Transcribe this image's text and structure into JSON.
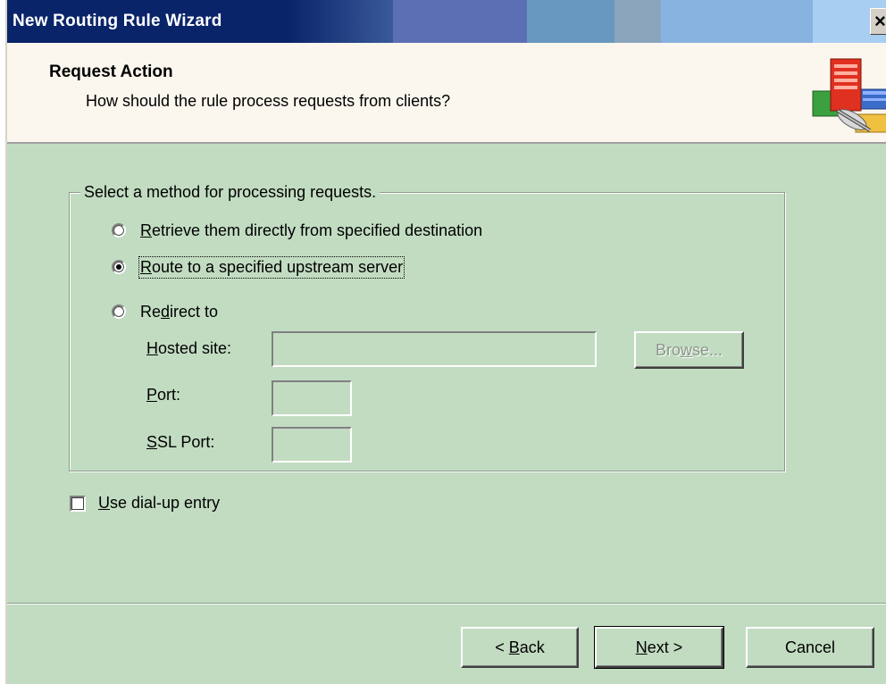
{
  "window": {
    "title": "New Routing Rule Wizard",
    "close_glyph": "×"
  },
  "header": {
    "heading": "Request Action",
    "subheading": "How should the rule process requests from clients?",
    "icon": "routing-server-icon"
  },
  "group": {
    "legend": "Select a method for processing requests.",
    "options": [
      {
        "pre": "",
        "mnemonic": "R",
        "post": "etrieve them directly from specified destination",
        "checked": false
      },
      {
        "pre": "",
        "mnemonic": "R",
        "post": "oute to a specified upstream server",
        "checked": true
      },
      {
        "pre": "Re",
        "mnemonic": "d",
        "post": "irect to",
        "checked": false
      }
    ],
    "hosted_site": {
      "mnemonic": "H",
      "rest": "osted site:",
      "value": ""
    },
    "port": {
      "mnemonic": "P",
      "rest": "ort:",
      "value": ""
    },
    "ssl_port": {
      "mnemonic": "S",
      "rest": "SL Port:",
      "value": ""
    },
    "browse": {
      "pre": "Bro",
      "mnemonic": "w",
      "post": "se..."
    }
  },
  "dialup": {
    "mnemonic": "U",
    "rest": "se dial-up entry",
    "checked": false
  },
  "buttons": {
    "back": {
      "pre": "< ",
      "mnemonic": "B",
      "post": "ack"
    },
    "next": {
      "pre": "",
      "mnemonic": "N",
      "post": "ext >"
    },
    "cancel": "Cancel"
  },
  "colors": {
    "dialog_bg": "#c2dcc2",
    "header_bg": "#fbf7ee",
    "title_active": "#0a246a"
  }
}
